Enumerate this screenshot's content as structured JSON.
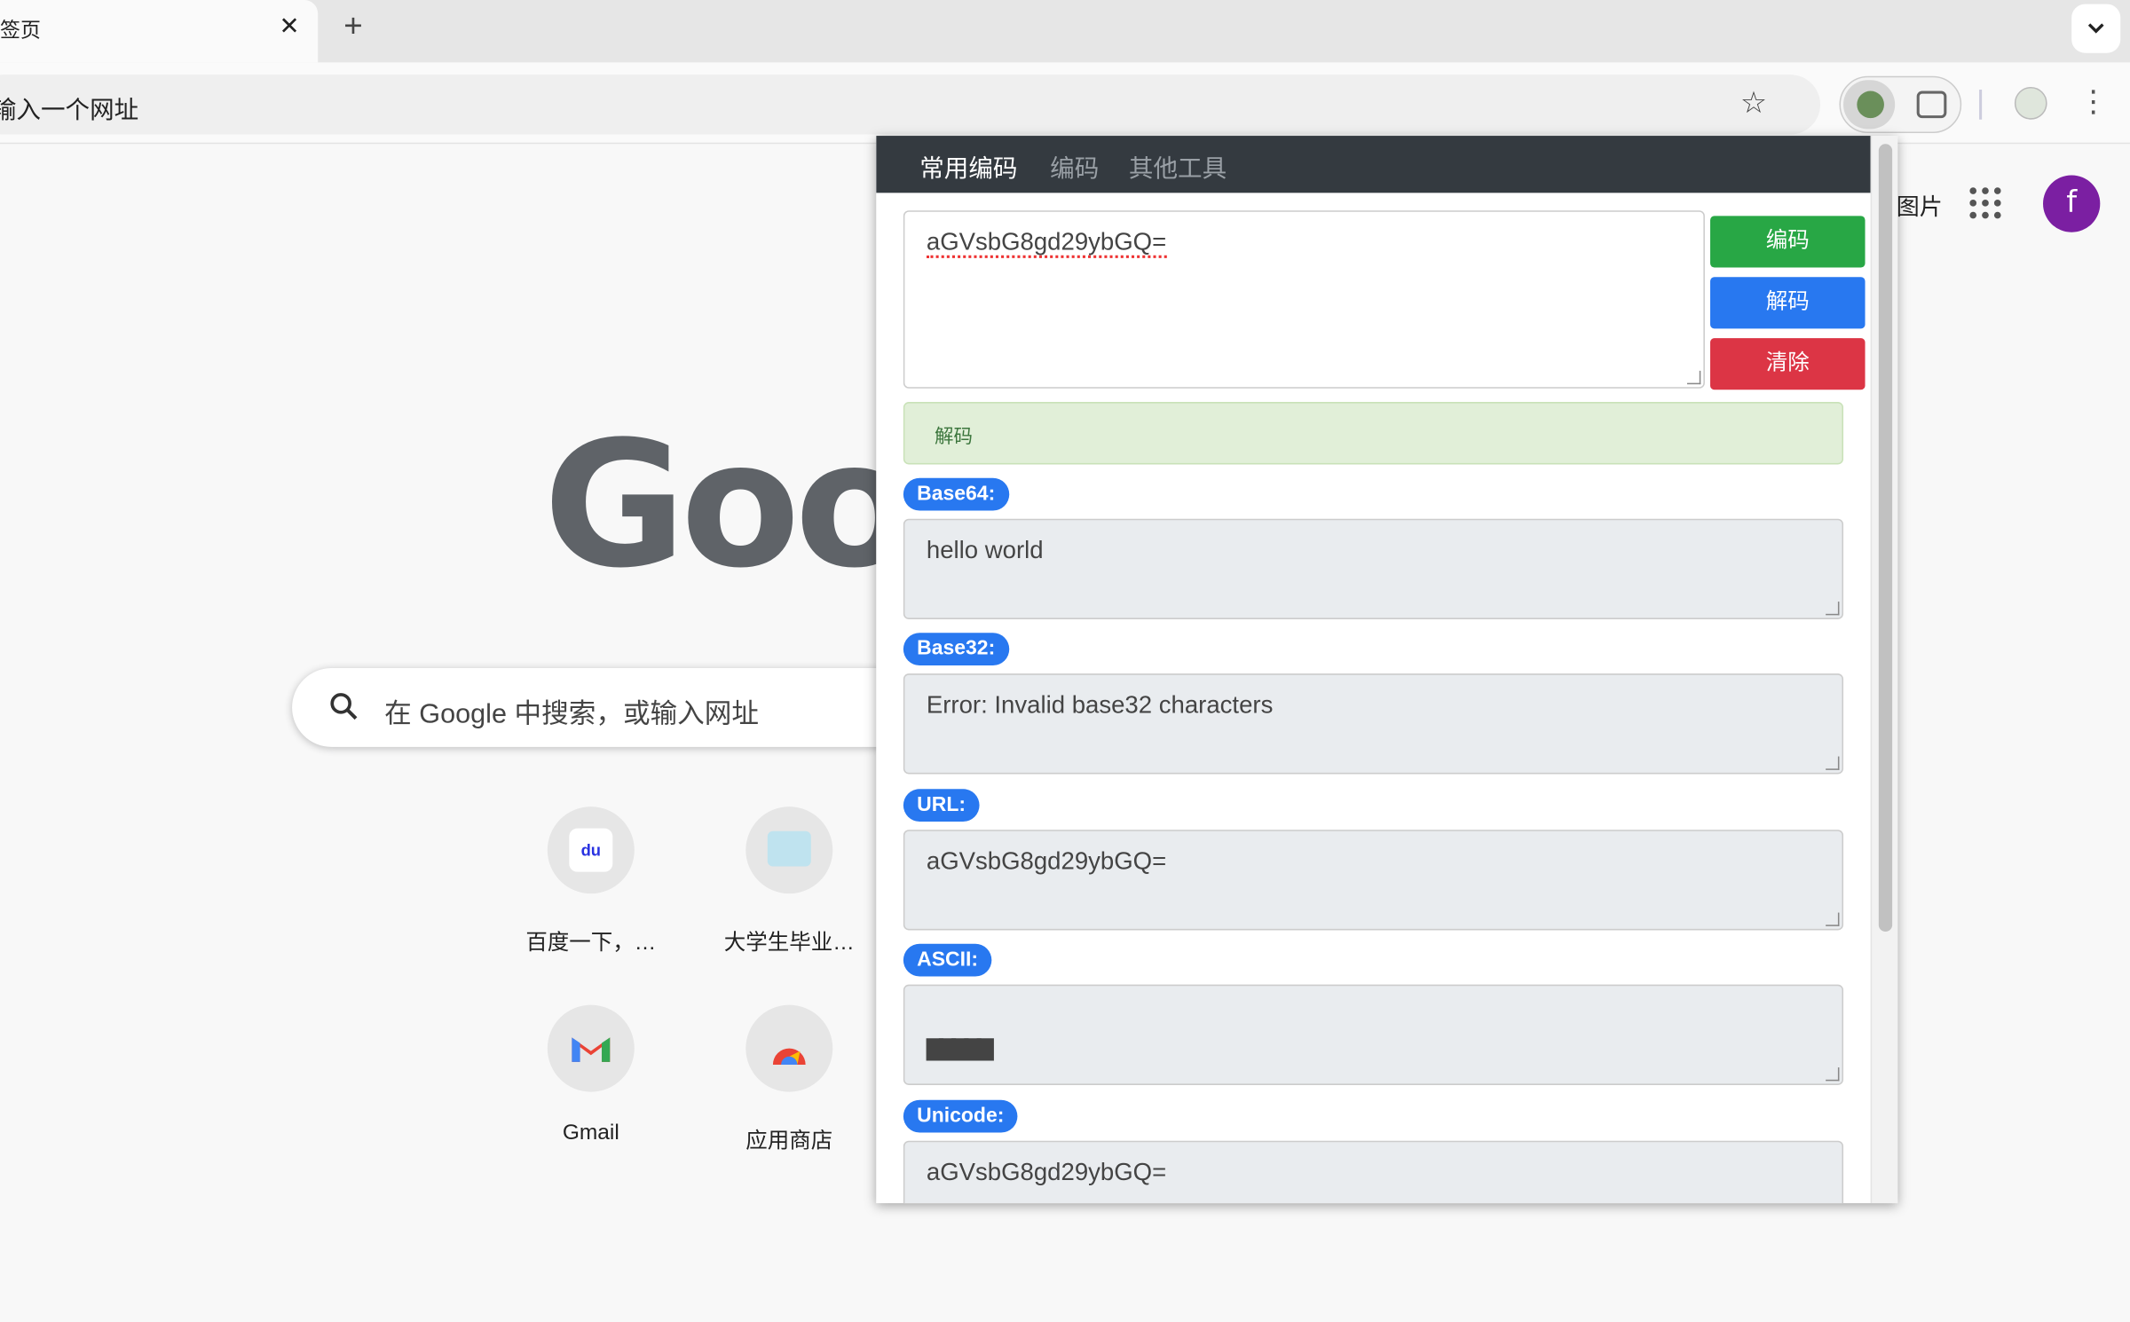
{
  "browser": {
    "tab_title": "新标签页",
    "tab_close": "✕",
    "new_tab": "+",
    "tab_search_icon": "chevron-down",
    "omnibox_placeholder": "在 Google 中搜索，或输入一个网址",
    "star_icon": "☆",
    "menu_icon": "⋮"
  },
  "ntp": {
    "images_link": "图片",
    "account_initial": "f",
    "logo": "Google",
    "search_placeholder": "在 Google 中搜索，或输入网址",
    "shortcuts": [
      {
        "label": "百度一下，…",
        "icon": "du"
      },
      {
        "label": "大学生毕业…"
      },
      {
        "label": "Gmail"
      },
      {
        "label": "应用商店"
      }
    ]
  },
  "popup": {
    "tabs": [
      "常用编码",
      "编码",
      "其他工具"
    ],
    "input_value": "aGVsbG8gd29ybGQ=",
    "buttons": {
      "encode": "编码",
      "decode": "解码",
      "clear": "清除"
    },
    "status": "解码",
    "outputs": [
      {
        "label": "Base64:",
        "value": "hello world"
      },
      {
        "label": "Base32:",
        "value": "Error: Invalid base32 characters"
      },
      {
        "label": "URL:",
        "value": "aGVsbG8gd29ybGQ="
      },
      {
        "label": "ASCII:",
        "value": "▇▇▇▇▇"
      },
      {
        "label": "Unicode:",
        "value": "aGVsbG8gd29ybGQ="
      }
    ],
    "colors": {
      "nav_bg": "#343a40",
      "encode": "#28a745",
      "decode": "#2878f0",
      "clear": "#dc3545",
      "badge": "#2878f0",
      "status_bg": "#e1efd8"
    }
  }
}
